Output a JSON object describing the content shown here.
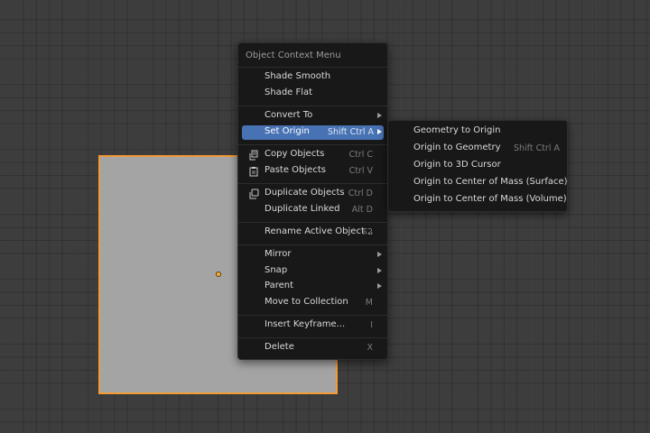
{
  "context_menu": {
    "title": "Object Context Menu",
    "items": [
      {
        "label": "Shade Smooth",
        "shortcut": ""
      },
      {
        "label": "Shade Flat",
        "shortcut": ""
      },
      {
        "label": "Convert To",
        "shortcut": "",
        "submenu": true
      },
      {
        "label": "Set Origin",
        "shortcut": "Shift Ctrl A",
        "submenu": true,
        "highlighted": true
      },
      {
        "label": "Copy Objects",
        "shortcut": "Ctrl C",
        "icon": "copy-icon"
      },
      {
        "label": "Paste Objects",
        "shortcut": "Ctrl V",
        "icon": "paste-icon"
      },
      {
        "label": "Duplicate Objects",
        "shortcut": "Ctrl D",
        "icon": "duplicate-icon"
      },
      {
        "label": "Duplicate Linked",
        "shortcut": "Alt D"
      },
      {
        "label": "Rename Active Object...",
        "shortcut": "F2"
      },
      {
        "label": "Mirror",
        "shortcut": "",
        "submenu": true
      },
      {
        "label": "Snap",
        "shortcut": "",
        "submenu": true
      },
      {
        "label": "Parent",
        "shortcut": "",
        "submenu": true
      },
      {
        "label": "Move to Collection",
        "shortcut": "M"
      },
      {
        "label": "Insert Keyframe...",
        "shortcut": "I"
      },
      {
        "label": "Delete",
        "shortcut": "X"
      }
    ]
  },
  "set_origin_submenu": {
    "items": [
      {
        "label": "Geometry to Origin",
        "shortcut": ""
      },
      {
        "label": "Origin to Geometry",
        "shortcut": "Shift Ctrl A"
      },
      {
        "label": "Origin to 3D Cursor",
        "shortcut": ""
      },
      {
        "label": "Origin to Center of Mass (Surface)",
        "shortcut": ""
      },
      {
        "label": "Origin to Center of Mass (Volume)",
        "shortcut": ""
      }
    ]
  },
  "colors": {
    "highlight": "#4772b3",
    "selection_outline": "#f29b38",
    "menu_background": "#181818",
    "viewport_background": "#3d3d3d"
  }
}
